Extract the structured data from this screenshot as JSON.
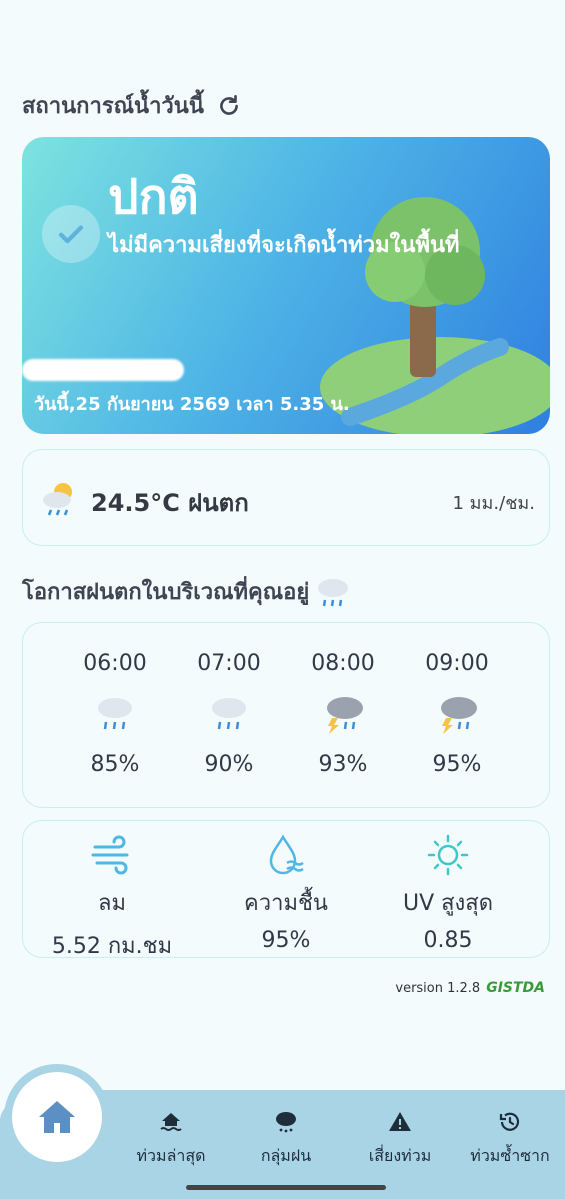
{
  "water_section": {
    "title": "สถานการณ์น้ำวันนี้",
    "refresh_icon": "refresh-icon"
  },
  "status_card": {
    "status": "ปกติ",
    "description": "ไม่มีความเสี่ยงที่จะเกิดน้ำท่วมในพื้นที่",
    "date_time": "วันนี้,25 กันยายน 2569 เวลา 5.35 น.",
    "icons": [
      "check-icon",
      "island-tree-illustration"
    ]
  },
  "weather": {
    "temperature_condition": "24.5°C ฝนตก",
    "rain_rate": "1 มม./ชม.",
    "icon": "sun-rain-cloud-icon"
  },
  "rain_section": {
    "title": "โอกาสฝนตกในบริเวณที่คุณอยู่",
    "icon": "rain-cloud-icon"
  },
  "forecast": [
    {
      "time": "06:00",
      "icon": "rain-cloud-icon",
      "chance": "85%"
    },
    {
      "time": "07:00",
      "icon": "rain-cloud-icon",
      "chance": "90%"
    },
    {
      "time": "08:00",
      "icon": "thunderstorm-icon",
      "chance": "93%"
    },
    {
      "time": "09:00",
      "icon": "thunderstorm-icon",
      "chance": "95%"
    }
  ],
  "metrics": [
    {
      "label": "ลม",
      "value": "5.52 กม.ชม",
      "icon": "wind-icon"
    },
    {
      "label": "ความชื้น",
      "value": "95%",
      "icon": "humidity-icon"
    },
    {
      "label": "UV สูงสุด",
      "value": "0.85",
      "icon": "sun-icon"
    }
  ],
  "footer": {
    "version": "version 1.2.8",
    "logo": "GISTDA"
  },
  "nav": [
    {
      "label": "ท่วมล่าสุด",
      "icon": "flood-house-icon"
    },
    {
      "label": "กลุ่มฝน",
      "icon": "rain-cloud-icon"
    },
    {
      "label": "เสี่ยงท่วม",
      "icon": "warning-icon"
    },
    {
      "label": "ท่วมซ้ำซาก",
      "icon": "history-icon"
    }
  ],
  "colors": {
    "accent": "#2f7fe0",
    "nav_bg": "#a8d4e6",
    "card_border": "#c9eef3"
  }
}
